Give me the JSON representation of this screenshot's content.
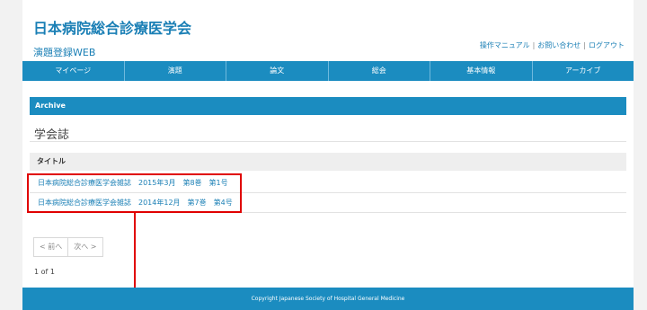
{
  "header": {
    "title": "日本病院総合診療医学会",
    "subtitle": "演題登録WEB",
    "links": [
      "操作マニュアル",
      "お問い合わせ",
      "ログアウト"
    ]
  },
  "nav": {
    "items": [
      "マイページ",
      "演題",
      "論文",
      "総会",
      "基本情報",
      "アーカイブ"
    ]
  },
  "panel": {
    "heading": "Archive",
    "section_title": "学会誌",
    "column_header": "タイトル",
    "rows": [
      "日本病院総合診療医学会雑誌　2015年3月　第8巻　第1号",
      "日本病院総合診療医学会雑誌　2014年12月　第7巻　第4号"
    ]
  },
  "pager": {
    "prev": "< 前へ",
    "next": "次へ >",
    "count": "1 of 1"
  },
  "footer": {
    "copyright": "Copyright Japanese Society of Hospital General Medicine"
  },
  "colors": {
    "accent": "#1b8cc0",
    "link": "#1a7fb5",
    "highlight": "#e00000"
  }
}
